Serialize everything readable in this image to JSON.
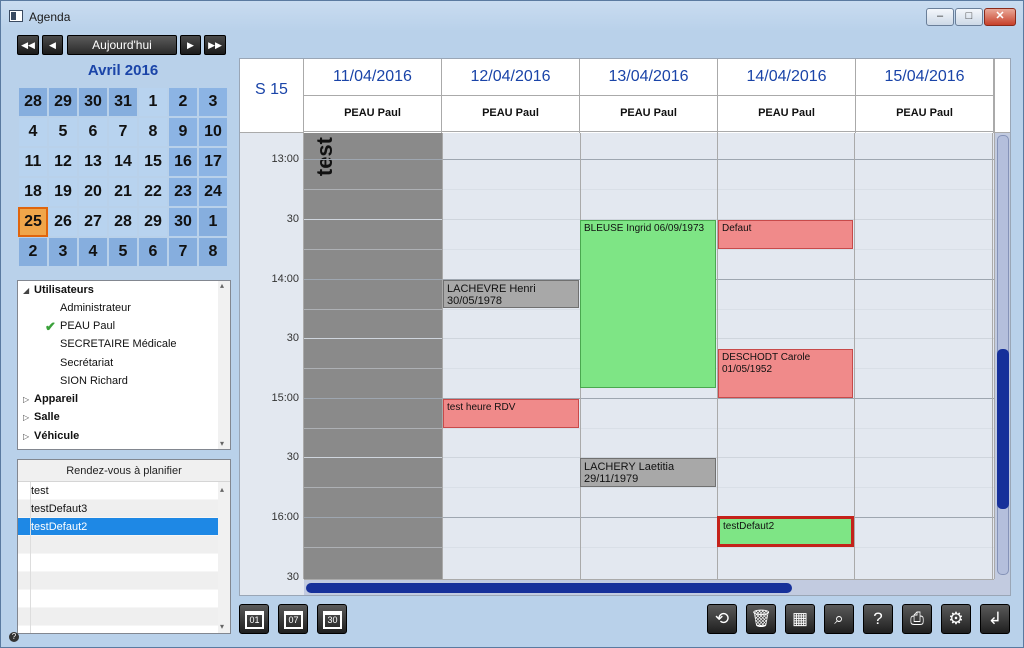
{
  "window": {
    "title": "Agenda",
    "min": "–",
    "max": "□",
    "close": "✕"
  },
  "nav": {
    "first": "◀◀",
    "prev": "◀",
    "today": "Aujourd'hui",
    "next": "▶",
    "last": "▶▶"
  },
  "calendar": {
    "month": "Avril 2016",
    "rows": [
      [
        "28",
        "29",
        "30",
        "31",
        "1",
        "2",
        "3"
      ],
      [
        "4",
        "5",
        "6",
        "7",
        "8",
        "9",
        "10"
      ],
      [
        "11",
        "12",
        "13",
        "14",
        "15",
        "16",
        "17"
      ],
      [
        "18",
        "19",
        "20",
        "21",
        "22",
        "23",
        "24"
      ],
      [
        "25",
        "26",
        "27",
        "28",
        "29",
        "30",
        "1"
      ],
      [
        "2",
        "3",
        "4",
        "5",
        "6",
        "7",
        "8"
      ]
    ],
    "today": "25"
  },
  "tree": {
    "groups": [
      {
        "label": "Utilisateurs",
        "expanded": true,
        "arrow": "◢",
        "children": [
          "Administrateur",
          "PEAU Paul",
          "SECRETAIRE Médicale",
          "Secrétariat",
          "SION Richard"
        ]
      },
      {
        "label": "Appareil",
        "expanded": false,
        "arrow": "▷"
      },
      {
        "label": "Salle",
        "expanded": false,
        "arrow": "▷"
      },
      {
        "label": "Véhicule",
        "expanded": false,
        "arrow": "▷"
      }
    ],
    "checked_user": "PEAU Paul",
    "check_glyph": "✔"
  },
  "rdv": {
    "header": "Rendez-vous à planifier",
    "items": [
      "test",
      "testDefaut3",
      "testDefaut2"
    ],
    "selected": "testDefaut2"
  },
  "agenda": {
    "week": "S 15",
    "days": [
      {
        "date": "11/04/2016",
        "user": "PEAU Paul"
      },
      {
        "date": "12/04/2016",
        "user": "PEAU Paul"
      },
      {
        "date": "13/04/2016",
        "user": "PEAU Paul"
      },
      {
        "date": "14/04/2016",
        "user": "PEAU Paul"
      },
      {
        "date": "15/04/2016",
        "user": "PEAU Paul"
      }
    ],
    "times": [
      "13:00",
      "30",
      "14:00",
      "30",
      "15:00",
      "30",
      "16:00",
      "30"
    ],
    "blocked_label": "test",
    "events": [
      {
        "day": "13/04/2016",
        "color": "green",
        "line1": "BLEUSE Ingrid 06/09/1973",
        "line2": ""
      },
      {
        "day": "14/04/2016",
        "color": "red",
        "line1": "Defaut",
        "line2": ""
      },
      {
        "day": "12/04/2016",
        "color": "gray",
        "line1": "LACHEVRE Henri",
        "line2": "30/05/1978"
      },
      {
        "day": "14/04/2016",
        "color": "red",
        "line1": "DESCHODT Carole",
        "line2": "01/05/1952"
      },
      {
        "day": "12/04/2016",
        "color": "red",
        "line1": "test heure RDV",
        "line2": ""
      },
      {
        "day": "13/04/2016",
        "color": "gray",
        "line1": "LACHERY Laetitia",
        "line2": "29/11/1979"
      },
      {
        "day": "14/04/2016",
        "color": "green",
        "line1": "testDefaut2",
        "line2": "",
        "selected": true
      }
    ]
  },
  "toolbar": {
    "view_day": "01",
    "view_week": "07",
    "view_month": "30",
    "refresh_icon": "⟲",
    "trash_icon": "🗑",
    "stats_icon": "▦",
    "search_icon": "⌕",
    "help_icon": "?",
    "print_icon": "⎙",
    "settings_icon": "⚙",
    "back_icon": "↲"
  },
  "help_badge": "?"
}
